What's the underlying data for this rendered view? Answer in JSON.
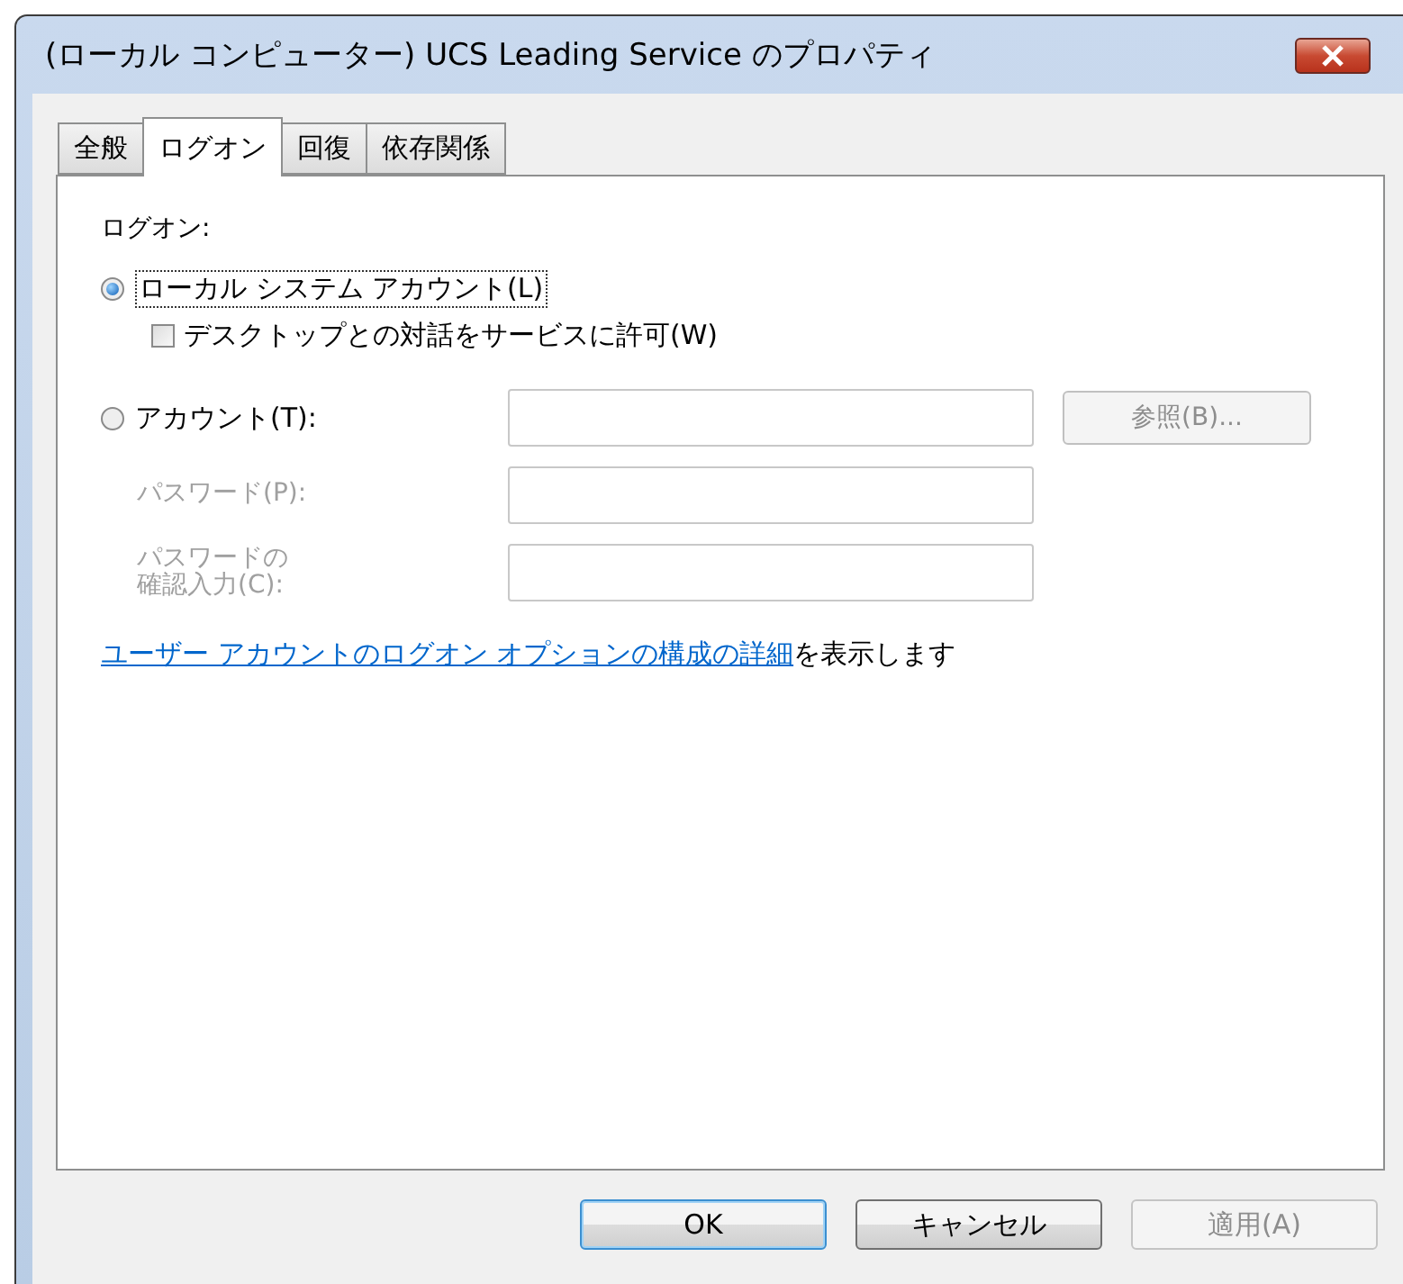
{
  "window": {
    "title": "(ローカル コンピューター) UCS Leading Service のプロパティ"
  },
  "tabs": [
    {
      "label": "全般",
      "selected": false
    },
    {
      "label": "ログオン",
      "selected": true
    },
    {
      "label": "回復",
      "selected": false
    },
    {
      "label": "依存関係",
      "selected": false
    }
  ],
  "logon": {
    "heading": "ログオン:",
    "local_system": {
      "label": "ローカル システム アカウント(L)",
      "selected": true
    },
    "interact": {
      "label": "デスクトップとの対話をサービスに許可(W)",
      "checked": false
    },
    "account": {
      "label": "アカウント(T):",
      "selected": false
    },
    "fields": [
      {
        "disabled": true
      },
      {
        "label_lines": [
          "パスワード(P):"
        ],
        "disabled": true
      },
      {
        "label_lines": [
          "パスワードの",
          "確認入力(C):"
        ],
        "disabled": true
      }
    ],
    "browse_button": {
      "label": "参照(B)...",
      "disabled": true
    },
    "link": {
      "link_text": "ユーザー アカウントのログオン オプションの構成の詳細",
      "rest": "を表示します"
    }
  },
  "buttons": [
    {
      "label": "OK",
      "default": true,
      "disabled": false
    },
    {
      "label": "キャンセル",
      "default": false,
      "disabled": false
    },
    {
      "label": "適用(A)",
      "default": false,
      "disabled": true
    }
  ]
}
